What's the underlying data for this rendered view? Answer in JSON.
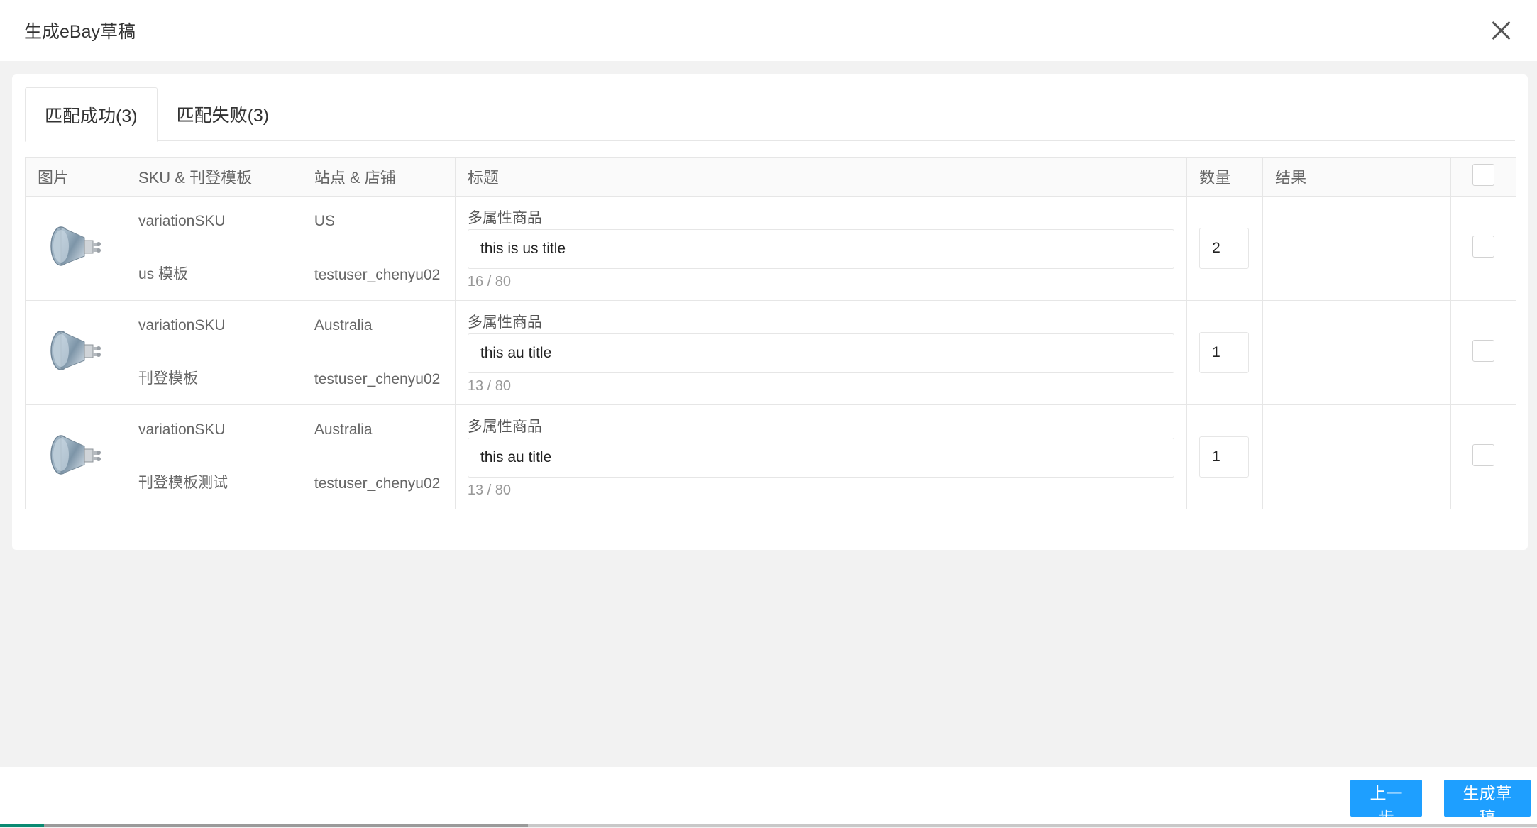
{
  "dialog": {
    "title": "生成eBay草稿"
  },
  "tabs": [
    {
      "label": "匹配成功(3)",
      "active": true
    },
    {
      "label": "匹配失败(3)",
      "active": false
    }
  ],
  "table": {
    "headers": {
      "image": "图片",
      "sku": "SKU & 刊登模板",
      "site": "站点 & 店铺",
      "title": "标题",
      "qty": "数量",
      "result": "结果"
    },
    "rows": [
      {
        "image": "bulb-icon",
        "sku": "variationSKU",
        "template": "us 模板",
        "site": "US",
        "store": "testuser_chenyu02",
        "title_label": "多属性商品",
        "title_value": "this is us title",
        "title_count": "16 / 80",
        "qty": "2",
        "result": ""
      },
      {
        "image": "bulb-icon",
        "sku": "variationSKU",
        "template": "刊登模板",
        "site": "Australia",
        "store": "testuser_chenyu02",
        "title_label": "多属性商品",
        "title_value": "this au title",
        "title_count": "13 / 80",
        "qty": "1",
        "result": ""
      },
      {
        "image": "bulb-icon",
        "sku": "variationSKU",
        "template": "刊登模板测试",
        "site": "Australia",
        "store": "testuser_chenyu02",
        "title_label": "多属性商品",
        "title_value": "this au title",
        "title_count": "13 / 80",
        "qty": "1",
        "result": ""
      }
    ]
  },
  "footer": {
    "prev_label": "上一步",
    "generate_label": "生成草稿"
  },
  "colors": {
    "primary_button": "#1E9FFF",
    "page_background": "#f2f2f2"
  }
}
